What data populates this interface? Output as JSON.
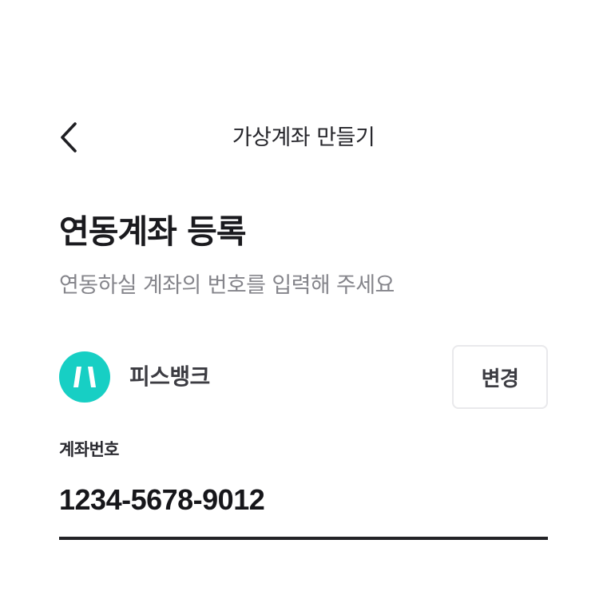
{
  "header": {
    "title": "가상계좌 만들기",
    "back_icon": "chevron-left-icon"
  },
  "main": {
    "title": "연동계좌 등록",
    "subtitle": "연동하실 계좌의 번호를 입력해 주세요"
  },
  "bank": {
    "name": "피스뱅크",
    "logo_icon": "bank-logo-icon",
    "logo_color": "#17cfc4",
    "change_label": "변경"
  },
  "account": {
    "label": "계좌번호",
    "value": "1234-5678-9012"
  },
  "colors": {
    "accent": "#17cfc4",
    "text_primary": "#1a1a1e",
    "text_secondary": "#85858b",
    "underline": "#222226"
  }
}
